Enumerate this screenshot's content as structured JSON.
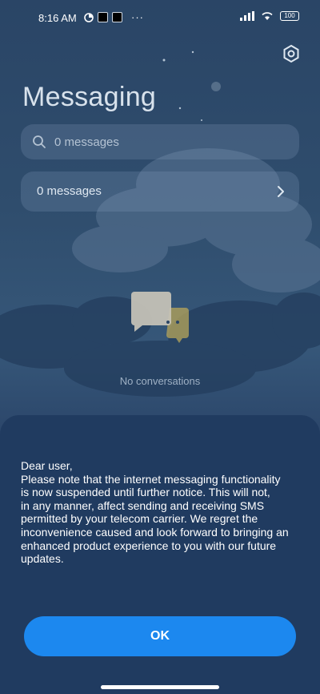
{
  "status_bar": {
    "time": "8:16 AM",
    "battery": "100",
    "more": "···"
  },
  "header": {
    "title": "Messaging"
  },
  "search": {
    "placeholder": "0 messages"
  },
  "messages_row": {
    "label": "0 messages"
  },
  "empty_state": {
    "text": "No conversations"
  },
  "dialog": {
    "greeting": "Dear user,",
    "body": "Please note that the internet messaging functionality\nis now suspended until further notice. This will not,\nin any manner, affect sending and receiving SMS\npermitted by your telecom carrier. We regret the\ninconvenience caused and look forward to bringing an\nenhanced product experience to you with our future\nupdates.",
    "ok_label": "OK"
  },
  "colors": {
    "accent": "#1c88ef",
    "sheet": "#203b60",
    "background": "#2f4d6d"
  }
}
